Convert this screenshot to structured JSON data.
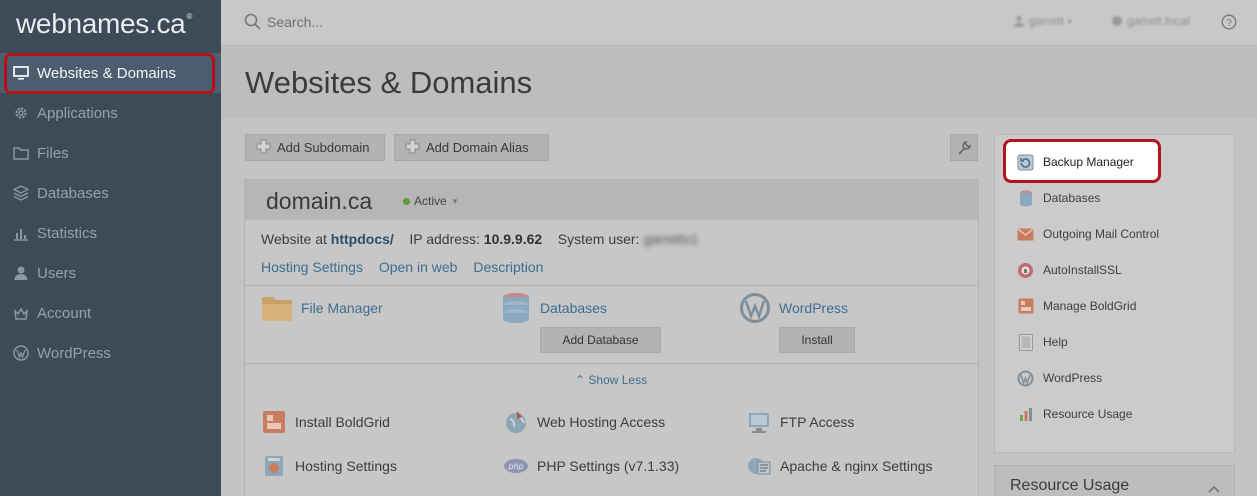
{
  "brand": {
    "logo_text": "webnames.ca",
    "logo_mark": "®"
  },
  "sidebar": {
    "items": [
      {
        "label": "Websites & Domains",
        "icon": "monitor-icon",
        "active": true
      },
      {
        "label": "Applications",
        "icon": "gear-icon"
      },
      {
        "label": "Files",
        "icon": "folder-icon"
      },
      {
        "label": "Databases",
        "icon": "layers-icon"
      },
      {
        "label": "Statistics",
        "icon": "bar-chart-icon"
      },
      {
        "label": "Users",
        "icon": "user-icon"
      },
      {
        "label": "Account",
        "icon": "account-icon"
      },
      {
        "label": "WordPress",
        "icon": "wordpress-icon"
      }
    ]
  },
  "topbar": {
    "search_placeholder": "Search...",
    "user": "garrett",
    "server": "garrett.local"
  },
  "page": {
    "title": "Websites & Domains"
  },
  "toolbar": {
    "add_subdomain": "Add Subdomain",
    "add_domain_alias": "Add Domain Alias"
  },
  "domain": {
    "name": "domain.ca",
    "status": "Active",
    "website_at_label": "Website at",
    "website_at_value": "httpdocs/",
    "ip_label": "IP address:",
    "ip_value": "10.9.9.62",
    "system_user_label": "System user:",
    "system_user_value": "garrettx1",
    "links": [
      "Hosting Settings",
      "Open in web",
      "Description"
    ],
    "tools": {
      "file_manager": "File Manager",
      "databases": "Databases",
      "add_database": "Add Database",
      "wordpress": "WordPress",
      "install": "Install"
    },
    "show_less": "Show Less",
    "mini_tools": [
      [
        "Install BoldGrid",
        "Web Hosting Access",
        "FTP Access"
      ],
      [
        "Hosting Settings",
        "PHP Settings (v7.1.33)",
        "Apache & nginx Settings"
      ]
    ]
  },
  "right_panel": {
    "items": [
      {
        "label": "Backup Manager",
        "icon": "backup-icon"
      },
      {
        "label": "Databases",
        "icon": "database-icon"
      },
      {
        "label": "Outgoing Mail Control",
        "icon": "mail-icon"
      },
      {
        "label": "AutoInstallSSL",
        "icon": "ssl-icon"
      },
      {
        "label": "Manage BoldGrid",
        "icon": "boldgrid-icon"
      },
      {
        "label": "Help",
        "icon": "help-doc-icon"
      },
      {
        "label": "WordPress",
        "icon": "wordpress-icon"
      },
      {
        "label": "Resource Usage",
        "icon": "bar-chart-icon"
      }
    ]
  },
  "resource_usage": {
    "title": "Resource Usage"
  },
  "colors": {
    "highlight": "#b3141c",
    "sidebar_bg": "#3d4a57",
    "link": "#3c6e91"
  }
}
